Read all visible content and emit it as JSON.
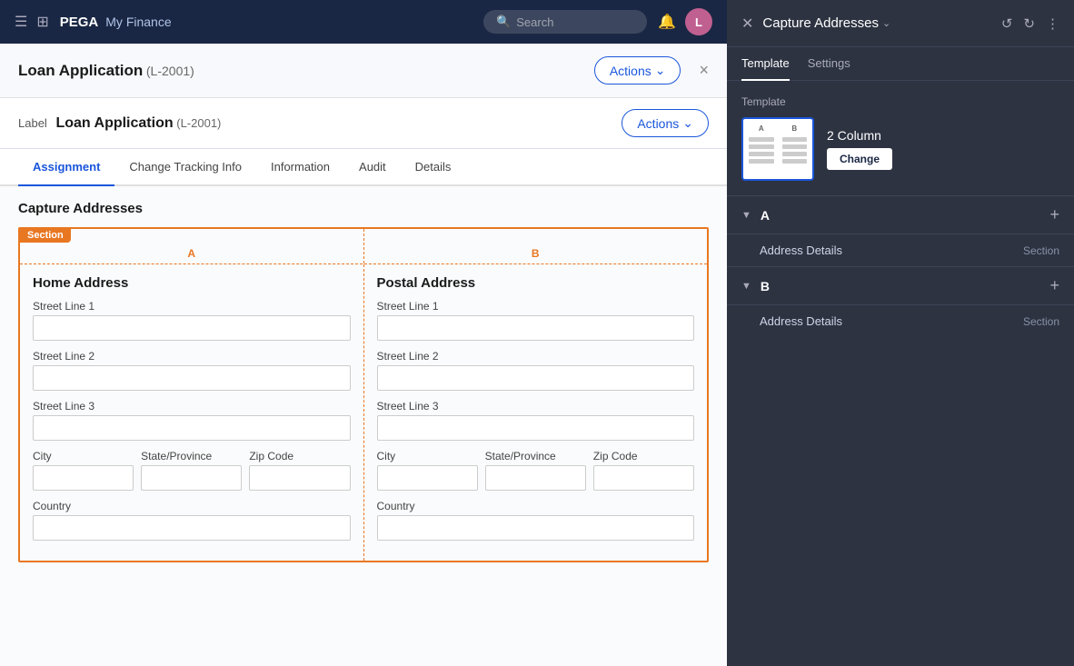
{
  "topNav": {
    "logo": "PEGA",
    "appName": "My Finance",
    "searchPlaceholder": "Search",
    "avatarInitial": "L"
  },
  "caseHeader": {
    "title": "Loan Application",
    "caseId": "(L-2001)",
    "actionsLabel": "Actions",
    "closeIcon": "×"
  },
  "labelRow": {
    "labelText": "Label",
    "caseName": "Loan Application",
    "caseId": "(L-2001)",
    "actionsLabel": "Actions"
  },
  "tabs": [
    {
      "label": "Assignment",
      "active": true
    },
    {
      "label": "Change Tracking Info",
      "active": false
    },
    {
      "label": "Information",
      "active": false
    },
    {
      "label": "Audit",
      "active": false
    },
    {
      "label": "Details",
      "active": false
    }
  ],
  "sectionTitle": "Capture Addresses",
  "sectionBadge": "Section",
  "columns": {
    "labelA": "A",
    "labelB": "B",
    "colA": {
      "heading": "Home Address",
      "fields": [
        {
          "label": "Street Line 1"
        },
        {
          "label": "Street Line 2"
        },
        {
          "label": "Street Line 3"
        }
      ],
      "inlineFields": [
        {
          "label": "City"
        },
        {
          "label": "State/Province"
        },
        {
          "label": "Zip Code"
        }
      ],
      "countryLabel": "Country"
    },
    "colB": {
      "heading": "Postal Address",
      "fields": [
        {
          "label": "Street Line 1"
        },
        {
          "label": "Street Line 2"
        },
        {
          "label": "Street Line 3"
        }
      ],
      "inlineFields": [
        {
          "label": "City"
        },
        {
          "label": "State/Province"
        },
        {
          "label": "Zip Code"
        }
      ],
      "countryLabel": "Country"
    }
  },
  "rightPanel": {
    "title": "Capture Addresses",
    "tabs": [
      {
        "label": "Template",
        "active": true
      },
      {
        "label": "Settings",
        "active": false
      }
    ],
    "templateLabel": "Template",
    "templateName": "2 Column",
    "changeBtn": "Change",
    "sections": [
      {
        "letter": "A",
        "items": [
          {
            "name": "Address Details",
            "type": "Section"
          }
        ]
      },
      {
        "letter": "B",
        "items": [
          {
            "name": "Address Details",
            "type": "Section"
          }
        ]
      }
    ]
  }
}
